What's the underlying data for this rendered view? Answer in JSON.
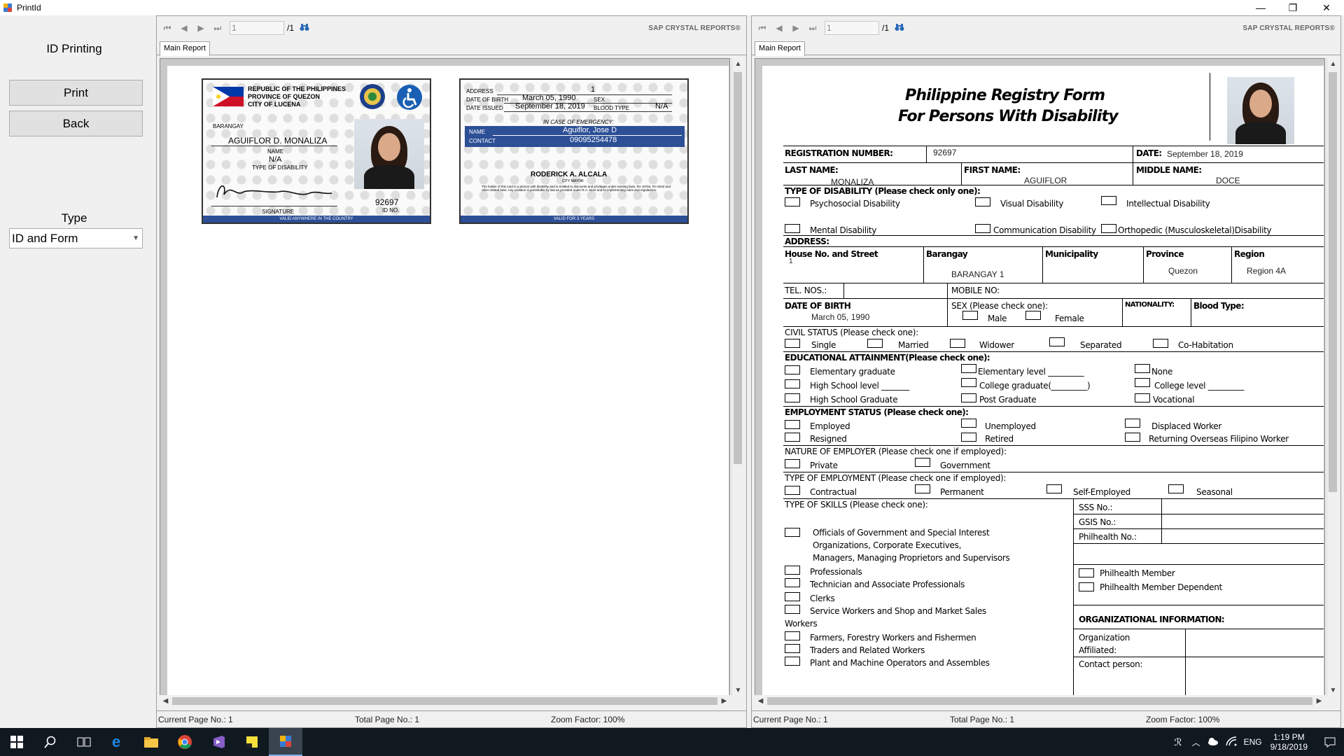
{
  "window": {
    "title": "PrintId",
    "minimize": "—",
    "maximize": "❐",
    "close": "✕"
  },
  "left_panel": {
    "heading": "ID Printing",
    "print_button": "Print",
    "back_button": "Back",
    "type_label": "Type",
    "type_selected": "ID and Form"
  },
  "viewer_left": {
    "page_input": "1",
    "page_total": "/1",
    "brand": "SAP CRYSTAL REPORTS®",
    "tab": "Main Report",
    "status_current": "Current Page No.: 1",
    "status_total": "Total Page No.: 1",
    "status_zoom": "Zoom Factor: 100%"
  },
  "viewer_right": {
    "page_input": "1",
    "page_total": "/1",
    "brand": "SAP CRYSTAL REPORTS®",
    "tab": "Main Report",
    "status_current": "Current Page No.: 1",
    "status_total": "Total Page No.: 1",
    "status_zoom": "Zoom Factor: 100%"
  },
  "id_front": {
    "header1": "REPUBLIC OF THE PHILIPPINES",
    "header2": "PROVINCE OF QUEZON",
    "header3": "CITY OF LUCENA",
    "barangay_label": "BARANGAY",
    "name": "AGUIFLOR D. MONALIZA",
    "name_label": "NAME",
    "disability": "N/A",
    "disability_label": "TYPE OF DISABILITY",
    "id_no": "92697",
    "id_no_label": "ID NO.",
    "signature_label": "SIGNATURE",
    "footer": "VALID ANYWHERE IN THE COUNTRY"
  },
  "id_back": {
    "address_label": "ADDRESS",
    "address": "1",
    "dob_label": "DATE OF BIRTH",
    "dob": "March 05, 1990",
    "sex_label": "SEX",
    "issued_label": "DATE ISSUED",
    "issued": "September 18, 2019",
    "blood_label": "BLOOD TYPE",
    "blood": "N/A",
    "emergency_label": "IN CASE OF EMERGENCY:",
    "ename_label": "NAME",
    "ename": "Aguiflor, Jose D",
    "contact_label": "CONTACT",
    "contact": "09095254478",
    "mayor": "RODERICK A. ALCALA",
    "mayor_title": "CITY MAYOR",
    "legal_text": "The holder of this card is a person with disability and is entitled to discounts and privileges under existing laws, RA 10754, RA 9442 and other related laws. Any violation is punishable by law as provided under R.A. 9442 and its implementing rules and regulations.",
    "footer": "VALID FOR 3 YEARS"
  },
  "form": {
    "title1": "Philippine Registry Form",
    "title2": "For Persons With Disability",
    "reg_no_label": "REGISTRATION NUMBER:",
    "reg_no": "92697",
    "date_label": "DATE:",
    "date": "September 18, 2019",
    "last_name_label": "LAST NAME:",
    "last_name": "MONALIZA",
    "first_name_label": "FIRST NAME:",
    "first_name": "AGUIFLOR",
    "middle_name_label": "MIDDLE NAME:",
    "middle_name": "DOCE",
    "disability_label": "TYPE OF DISABILITY  (Please check only one):",
    "disabilities": [
      "Psychosocial Disability",
      "Visual Disability",
      "Intellectual Disability",
      "Mental Disability",
      "Communication Disability",
      "Orthopedic (Musculoskeletal)Disability"
    ],
    "address_label": "ADDRESS:",
    "house_label": "House No. and Street",
    "house": "1",
    "barangay_label": "Barangay",
    "barangay": "BARANGAY 1",
    "municipality_label": "Municipality",
    "province_label": "Province",
    "province": "Quezon",
    "region_label": "Region",
    "region": "Region 4A",
    "tel_label": "TEL. NOS.:",
    "mobile_label": "MOBILE NO:",
    "dob_label": "DATE OF BIRTH",
    "dob": "March 05, 1990",
    "sex_label": "SEX (Please check one):",
    "male": "Male",
    "female": "Female",
    "nationality_label": "NATIONALITY:",
    "blood_label": "Blood Type:",
    "civil_label": "CIVIL STATUS (Please check one):",
    "civil": [
      "Single",
      "Married",
      "Widower",
      "Separated",
      "Co-Habitation"
    ],
    "edu_label": "EDUCATIONAL ATTAINMENT(Please check one):",
    "edu": [
      "Elementary  graduate",
      "Elementary level _________",
      "None",
      "High School level _______",
      "College graduate(_________)",
      "College level _________",
      "High School Graduate",
      "Post Graduate",
      "Vocational"
    ],
    "emp_label": "EMPLOYMENT STATUS (Please check one):",
    "emp": [
      "Employed",
      "Unemployed",
      "Displaced Worker",
      "Resigned",
      "Retired",
      "Returning Overseas Filipino Worker"
    ],
    "nature_label": "NATURE OF EMPLOYER (Please check one if employed):",
    "nature": [
      "Private",
      "Government"
    ],
    "type_emp_label": "TYPE OF EMPLOYMENT (Please check one if employed):",
    "type_emp": [
      "Contractual",
      "Permanent",
      "Self-Employed",
      "Seasonal"
    ],
    "skills_label": "TYPE OF SKILLS (Please check one):",
    "skills1a": "Officials of Government and Special Interest",
    "skills1b": "Organizations, Corporate Executives,",
    "skills1c": "Managers, Managing Proprietors and Supervisors",
    "skills2": "Professionals",
    "skills3": "Technician and Associate Professionals",
    "skills4": "Clerks",
    "skills5a": "Service Workers and Shop and Market Sales",
    "skills5b": "Workers",
    "skills6": "Farmers, Forestry Workers and Fishermen",
    "skills7": "Traders and Related Workers",
    "skills8": "Plant and Machine Operators and Assembles",
    "sss_label": "SSS No.:",
    "gsis_label": "GSIS No.:",
    "phil_label": "Philhealth No.:",
    "phil_member": "Philhealth Member",
    "phil_dependent": "Philhealth Member Dependent",
    "org_label": "ORGANIZATIONAL INFORMATION:",
    "org_affil1": "Organization",
    "org_affil2": "Affiliated:",
    "contact_person": "Contact person:"
  },
  "taskbar": {
    "time": "1:19 PM",
    "date": "9/18/2019",
    "lang": "ENG"
  }
}
